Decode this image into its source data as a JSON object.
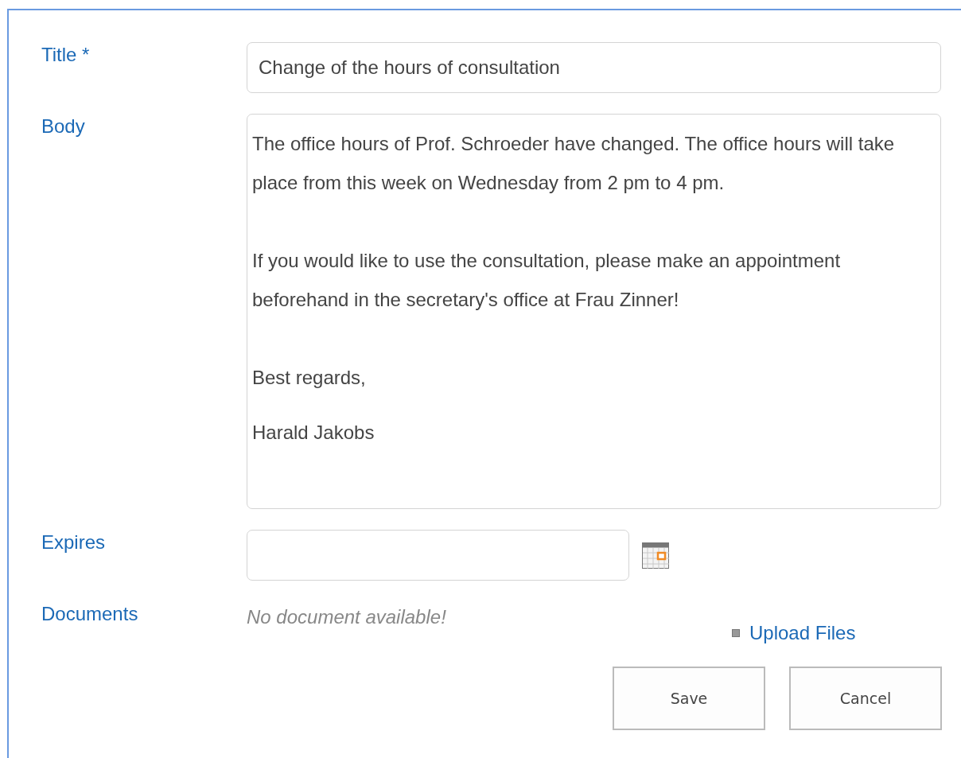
{
  "fields": [
    {
      "kind": "text",
      "label": "Title *",
      "value": "Change of the hours of consultation"
    },
    {
      "kind": "richtext",
      "label": "Body",
      "paragraphs": [
        "The office hours of Prof. Schroeder have changed. The office hours will take place from this week on Wednesday from 2 pm to 4 pm.",
        "If you would like to use the consultation, please make an appointment beforehand in the secretary's office at Frau Zinner!",
        "Best regards,",
        "Harald Jakobs"
      ]
    },
    {
      "kind": "date",
      "label": "Expires"
    },
    {
      "kind": "documents",
      "label": "Documents",
      "empty_text": "No document available!",
      "link": "Upload Files"
    }
  ],
  "buttons": [
    "Save",
    "Cancel"
  ]
}
